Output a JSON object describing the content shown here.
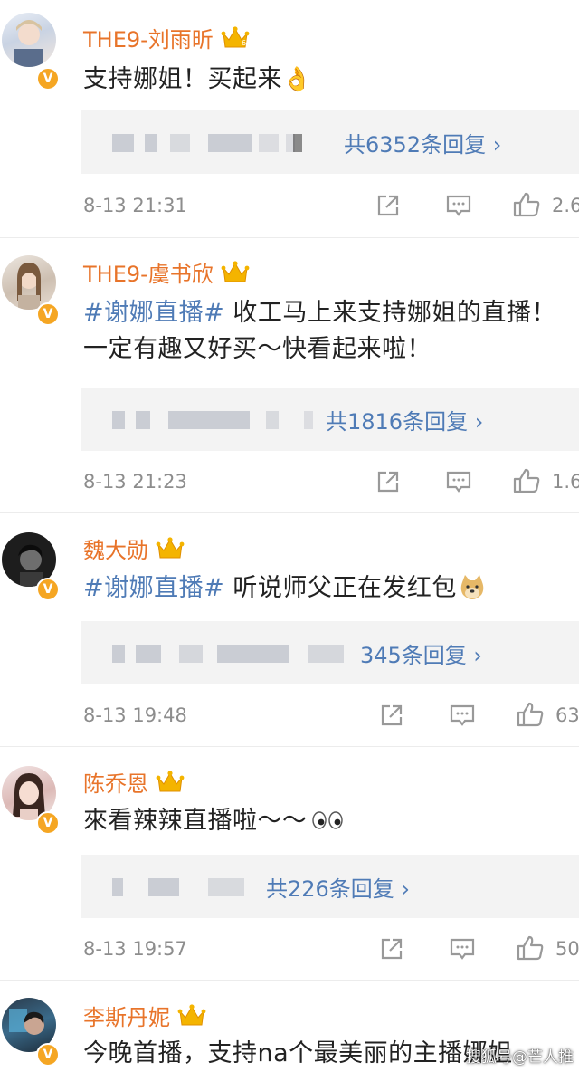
{
  "colors": {
    "name": "#e8742a",
    "topic": "#4f7bb6",
    "meta": "#8d8d8d",
    "verified": "#f5a623"
  },
  "comments": [
    {
      "user": "THE9-刘雨昕",
      "text_plain": "支持娜姐！买起来",
      "emoji_icon": "ok-hand-icon",
      "reply_fragment": "",
      "reply_link": "共6352条回复 ›",
      "time": "8-13 21:31",
      "like_count": "2.6"
    },
    {
      "user": "THE9-虞书欣",
      "topic": "#谢娜直播#",
      "text_plain": " 收工马上来支持娜姐的直播！一定有趣又好买～快看起来啦！",
      "reply_fragment": "共",
      "reply_link": "1816条回复 ›",
      "time": "8-13 21:23",
      "like_count": "1.6"
    },
    {
      "user": "魏大勋",
      "topic": "#谢娜直播#",
      "text_plain": " 听说师父正在发红包",
      "emoji_icon": "doge-icon",
      "reply_link": "345条回复 ›",
      "time": "8-13 19:48",
      "like_count": "63"
    },
    {
      "user": "陈乔恩",
      "text_plain": "來看辣辣直播啦～～",
      "emoji_icon": "eyes-icon",
      "reply_link": "共226条回复 ›",
      "time": "8-13 19:57",
      "like_count": "50"
    },
    {
      "user": "李斯丹妮",
      "text_plain": "今晚首播，支持na个最美丽的主播娜姐"
    }
  ],
  "watermark": "搜狐号@芒人推"
}
